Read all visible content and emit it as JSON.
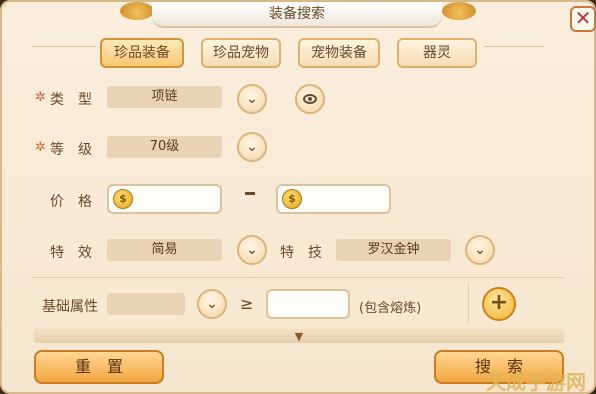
{
  "window": {
    "title": "装备搜索",
    "close_glyph": "✕"
  },
  "tabs": [
    {
      "label": "珍品装备",
      "active": true
    },
    {
      "label": "珍品宠物",
      "active": false
    },
    {
      "label": "宠物装备",
      "active": false
    },
    {
      "label": "器灵",
      "active": false
    }
  ],
  "form": {
    "required_mark": "✲",
    "type": {
      "label": "类　型",
      "value": "项链"
    },
    "level": {
      "label": "等　级",
      "value": "70级"
    },
    "price": {
      "label": "价　格",
      "separator": "-",
      "min": "",
      "max": ""
    },
    "effect": {
      "label": "特　效",
      "value": "简易"
    },
    "skill": {
      "label": "特　技",
      "value": "罗汉金钟"
    },
    "base_attr": {
      "label": "基础属性",
      "value": "",
      "operator": "≥",
      "amount": "",
      "note": "(包含熔炼)"
    }
  },
  "icons": {
    "dropdown": "chevron-down-icon",
    "eye": "eye-icon",
    "coin": "coin-icon",
    "plus": "plus-icon",
    "expand": "chevron-down-icon"
  },
  "glyphs": {
    "chevron": "⌄",
    "plus": "+",
    "coin": "$",
    "expand": "▼"
  },
  "buttons": {
    "reset": "重　置",
    "search": "搜　索"
  },
  "watermark": "天成手游网",
  "colors": {
    "accent": "#f2a640",
    "panel": "#fbeedd",
    "text": "#6b4a2a",
    "required": "#d9643a"
  }
}
